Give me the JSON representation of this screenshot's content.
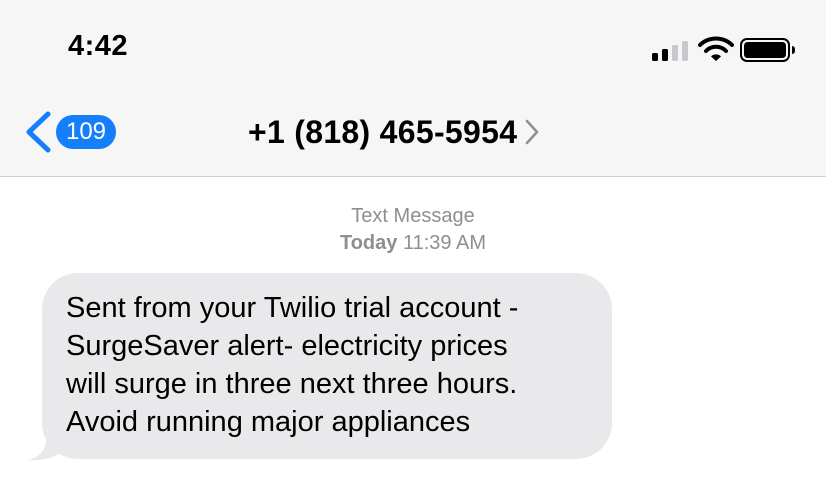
{
  "status_bar": {
    "time": "4:42",
    "icons": [
      "cellular-signal-icon",
      "wifi-icon",
      "battery-icon"
    ]
  },
  "nav": {
    "back_icon": "chevron-left-icon",
    "unread_count": "109",
    "contact": "+1 (818) 465-5954",
    "contact_chevron_icon": "chevron-right-icon"
  },
  "thread": {
    "service_label": "Text Message",
    "day": "Today",
    "time": "11:39 AM"
  },
  "message": {
    "lines": [
      "Sent from your Twilio trial account -",
      "SurgeSaver alert- electricity prices",
      "will surge in three next three hours.",
      "Avoid running major appliances"
    ]
  },
  "colors": {
    "accent": "#147efb",
    "header_bg": "#f6f6f7",
    "bubble_bg": "#e9e9eb",
    "meta_text": "#8e8e93"
  }
}
